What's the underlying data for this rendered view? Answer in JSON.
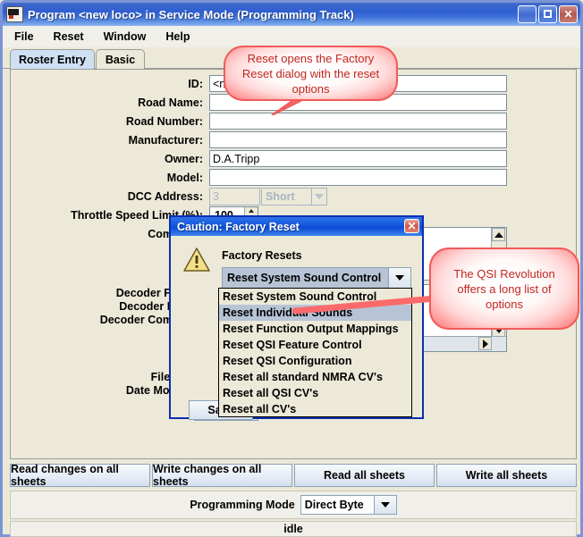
{
  "window": {
    "title": "Program <new loco> in Service Mode (Programming Track)",
    "icon": "locomotive-icon",
    "minimize_label": "_",
    "maximize_label": "",
    "close_label": "✕"
  },
  "menubar": {
    "items": [
      {
        "label": "File"
      },
      {
        "label": "Reset"
      },
      {
        "label": "Window"
      },
      {
        "label": "Help"
      }
    ]
  },
  "tabs": [
    {
      "label": "Roster Entry",
      "selected": true
    },
    {
      "label": "Basic",
      "selected": false
    }
  ],
  "form": {
    "fields": [
      {
        "label": "ID:",
        "value": "<n"
      },
      {
        "label": "Road Name:",
        "value": ""
      },
      {
        "label": "Road Number:",
        "value": ""
      },
      {
        "label": "Manufacturer:",
        "value": ""
      },
      {
        "label": "Owner:",
        "value": "D.A.Tripp"
      },
      {
        "label": "Model:",
        "value": ""
      }
    ],
    "dcc_address": {
      "label": "DCC Address:",
      "value": "3",
      "type_value": "Short"
    },
    "throttle_speed_limit": {
      "label": "Throttle Speed Limit (%):",
      "value": "100"
    },
    "comment": {
      "label": "Comment:",
      "value": ""
    },
    "decoder_family": {
      "label": "Decoder Family:",
      "value": ""
    },
    "decoder_model": {
      "label": "Decoder Model:",
      "value": ""
    },
    "decoder_comment": {
      "label": "Decoder Comment:",
      "value": ""
    },
    "filename": {
      "label": "Filename:",
      "value": ""
    },
    "date_modified": {
      "label": "Date Modified:",
      "value": ""
    },
    "save_label": "Save"
  },
  "bottom_buttons": [
    {
      "label": "Read changes on all sheets"
    },
    {
      "label": "Write changes on all sheets"
    },
    {
      "label": "Read all sheets"
    },
    {
      "label": "Write all sheets"
    }
  ],
  "programming_mode": {
    "label": "Programming Mode",
    "value": "Direct Byte"
  },
  "status": {
    "text": "idle"
  },
  "dialog": {
    "title": "Caution:  Factory Reset",
    "close_label": "✕",
    "icon": "warning-triangle-icon",
    "group_label": "Factory Resets",
    "selected_option": "Reset System Sound Control",
    "save_label": "Save",
    "options": [
      {
        "label": "Reset System Sound Control",
        "highlighted": false
      },
      {
        "label": "Reset Individual Sounds",
        "highlighted": true
      },
      {
        "label": "Reset Function Output Mappings",
        "highlighted": false
      },
      {
        "label": "Reset QSI Feature Control",
        "highlighted": false
      },
      {
        "label": "Reset QSI Configuration",
        "highlighted": false
      },
      {
        "label": "Reset all standard NMRA CV's",
        "highlighted": false
      },
      {
        "label": "Reset all QSI CV's",
        "highlighted": false
      },
      {
        "label": "Reset all CV's",
        "highlighted": false
      }
    ]
  },
  "callouts": [
    {
      "id": "callout1",
      "text": "Reset opens the Factory Reset dialog with the reset options"
    },
    {
      "id": "callout2",
      "text": "The QSI Revolution offers a long list of options"
    }
  ],
  "colors": {
    "title_blue": "#1257dd",
    "callout_red": "#c0261f",
    "callout_border": "#f25a5a",
    "tab_selected": "#cfe0f3",
    "highlight": "#b6c4d6"
  }
}
